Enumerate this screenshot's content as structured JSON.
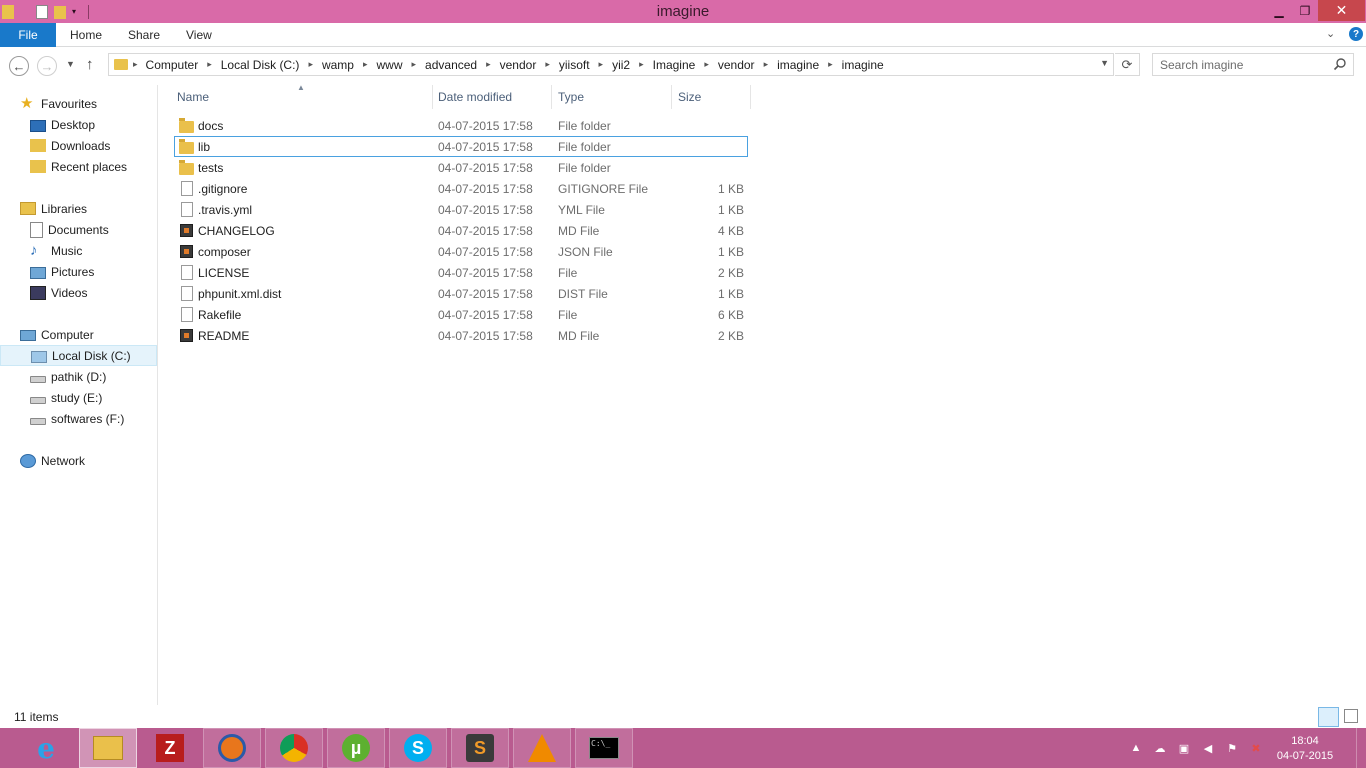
{
  "window": {
    "title": "imagine"
  },
  "ribbon": {
    "tabs": {
      "file": "File",
      "home": "Home",
      "share": "Share",
      "view": "View"
    }
  },
  "nav": {
    "breadcrumb": [
      "Computer",
      "Local Disk (C:)",
      "wamp",
      "www",
      "advanced",
      "vendor",
      "yiisoft",
      "yii2",
      "Imagine",
      "vendor",
      "imagine",
      "imagine"
    ],
    "search_placeholder": "Search imagine"
  },
  "sidebar": {
    "favourites": {
      "label": "Favourites",
      "items": [
        "Desktop",
        "Downloads",
        "Recent places"
      ]
    },
    "libraries": {
      "label": "Libraries",
      "items": [
        "Documents",
        "Music",
        "Pictures",
        "Videos"
      ]
    },
    "computer": {
      "label": "Computer",
      "items": [
        "Local Disk (C:)",
        "pathik (D:)",
        "study (E:)",
        "softwares (F:)"
      ]
    },
    "network": {
      "label": "Network"
    }
  },
  "columns": {
    "name": "Name",
    "date": "Date modified",
    "type": "Type",
    "size": "Size"
  },
  "files": [
    {
      "name": "docs",
      "date": "04-07-2015 17:58",
      "type": "File folder",
      "size": "",
      "icon": "folder"
    },
    {
      "name": "lib",
      "date": "04-07-2015 17:58",
      "type": "File folder",
      "size": "",
      "icon": "folder"
    },
    {
      "name": "tests",
      "date": "04-07-2015 17:58",
      "type": "File folder",
      "size": "",
      "icon": "folder"
    },
    {
      "name": ".gitignore",
      "date": "04-07-2015 17:58",
      "type": "GITIGNORE File",
      "size": "1 KB",
      "icon": "file"
    },
    {
      "name": ".travis.yml",
      "date": "04-07-2015 17:58",
      "type": "YML File",
      "size": "1 KB",
      "icon": "file"
    },
    {
      "name": "CHANGELOG",
      "date": "04-07-2015 17:58",
      "type": "MD File",
      "size": "4 KB",
      "icon": "md"
    },
    {
      "name": "composer",
      "date": "04-07-2015 17:58",
      "type": "JSON File",
      "size": "1 KB",
      "icon": "md"
    },
    {
      "name": "LICENSE",
      "date": "04-07-2015 17:58",
      "type": "File",
      "size": "2 KB",
      "icon": "file"
    },
    {
      "name": "phpunit.xml.dist",
      "date": "04-07-2015 17:58",
      "type": "DIST File",
      "size": "1 KB",
      "icon": "file"
    },
    {
      "name": "Rakefile",
      "date": "04-07-2015 17:58",
      "type": "File",
      "size": "6 KB",
      "icon": "file"
    },
    {
      "name": "README",
      "date": "04-07-2015 17:58",
      "type": "MD File",
      "size": "2 KB",
      "icon": "md"
    }
  ],
  "status": {
    "item_count": "11 items"
  },
  "taskbar": {
    "apps": [
      "internet-explorer-icon",
      "file-explorer-icon",
      "filezilla-icon",
      "firefox-icon",
      "chrome-icon",
      "utorrent-icon",
      "skype-icon",
      "sublime-text-icon",
      "vlc-icon",
      "command-prompt-icon"
    ],
    "clock_time": "18:04",
    "clock_date": "04-07-2015"
  },
  "colors": {
    "titlebar": "#d96aa8",
    "taskbar": "#b95b8f",
    "file_tab": "#1979ca",
    "selection": "#e5f3fb"
  }
}
